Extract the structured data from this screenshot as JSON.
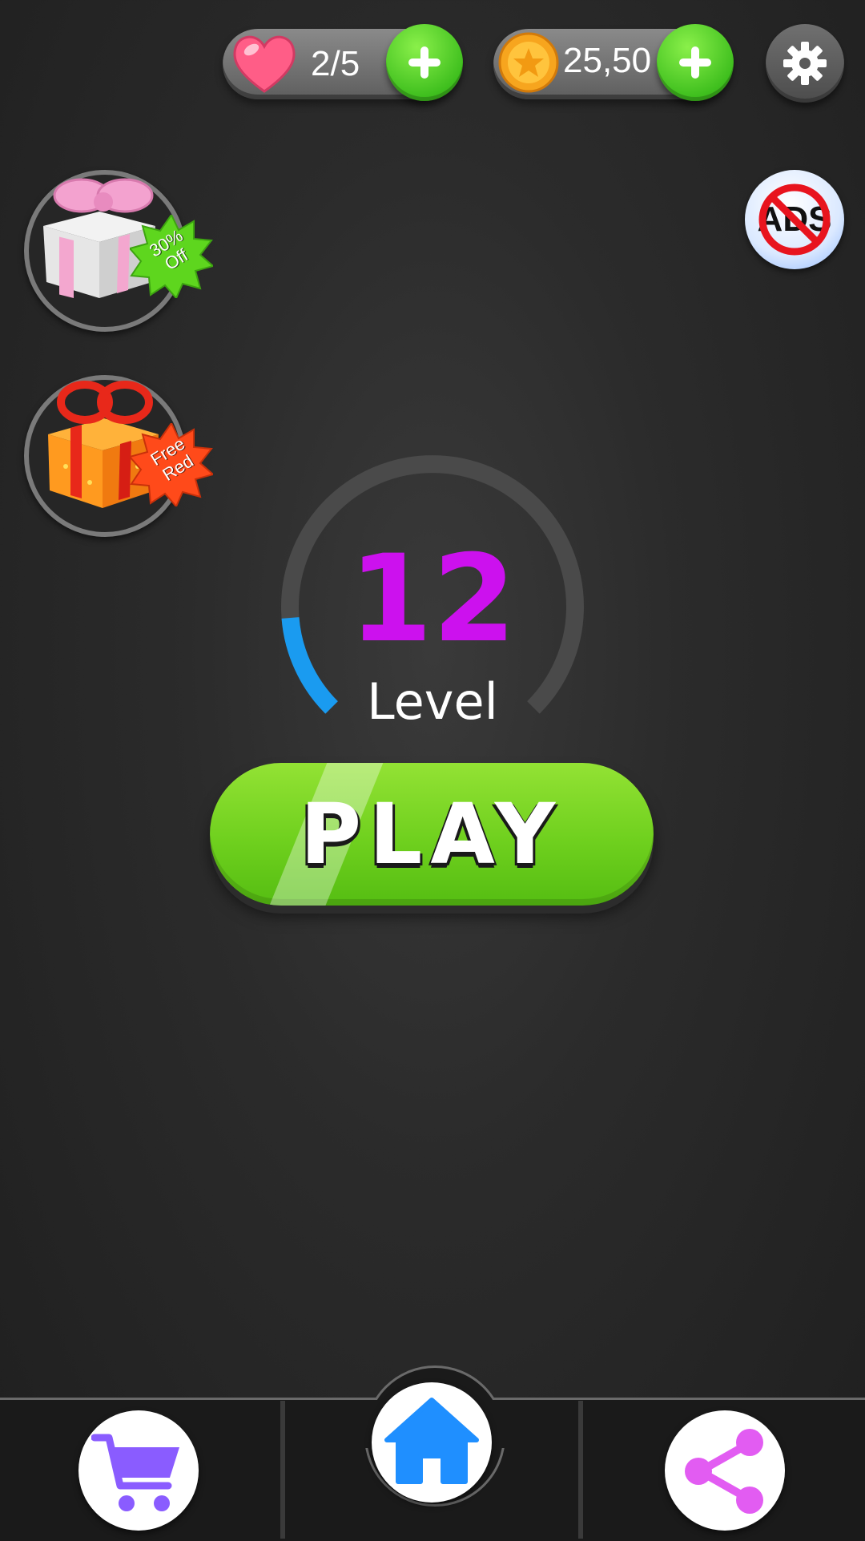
{
  "hud": {
    "lives": {
      "value": "2/5",
      "icon": "heart-icon"
    },
    "coins": {
      "value": "25,50",
      "icon": "coin-icon"
    },
    "add_icon": "plus-icon",
    "settings_icon": "gear-icon"
  },
  "offers": [
    {
      "icon": "pink-gift-icon",
      "badge_text": "30%\nOff",
      "badge_color": "#5ed61e"
    },
    {
      "icon": "orange-gift-icon",
      "badge_text": "Free\nRed",
      "badge_color": "#ff4a1a"
    }
  ],
  "no_ads": {
    "text": "ADS",
    "icon": "no-ads-icon"
  },
  "level": {
    "number": "12",
    "label": "Level",
    "progress": 0.15,
    "color": "#cc11ee"
  },
  "play": {
    "label": "PLAY",
    "color": "#6fd01e"
  },
  "nav": {
    "shop_icon": "cart-icon",
    "home_icon": "home-icon",
    "share_icon": "share-icon",
    "colors": {
      "shop": "#8a5cff",
      "home": "#1f8fff",
      "share": "#e25cf2"
    }
  }
}
